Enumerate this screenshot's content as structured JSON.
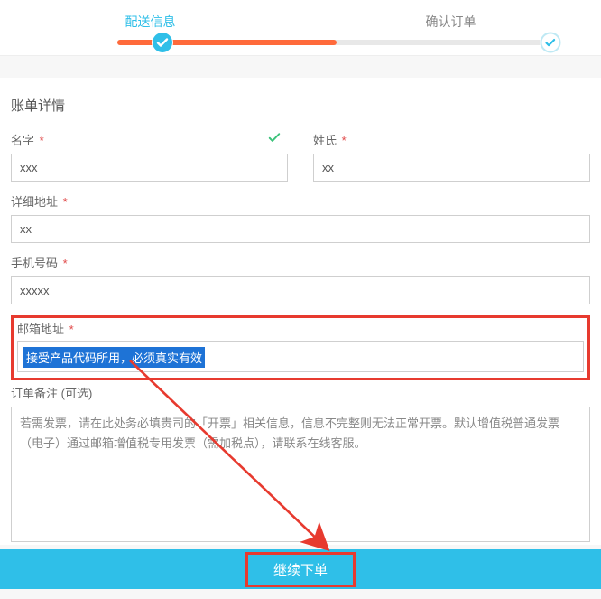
{
  "progress": {
    "step1": "配送信息",
    "step2": "确认订单"
  },
  "section_title": "账单详情",
  "fields": {
    "first_name_label": "名字",
    "first_name_value": "xxx",
    "last_name_label": "姓氏",
    "last_name_value": "xx",
    "address_label": "详细地址",
    "address_value": "xx",
    "phone_label": "手机号码",
    "phone_value": "xxxxx",
    "email_label": "邮箱地址",
    "email_placeholder": "接受产品代码所用，必须真实有效",
    "notes_label": "订单备注 (可选)",
    "notes_value": "若需发票，请在此处务必填贵司的「开票」相关信息，信息不完整则无法正常开票。默认增值税普通发票（电子）通过邮箱增值税专用发票（需加税点），请联系在线客服。"
  },
  "required_mark": "*",
  "submit_label": "继续下单"
}
